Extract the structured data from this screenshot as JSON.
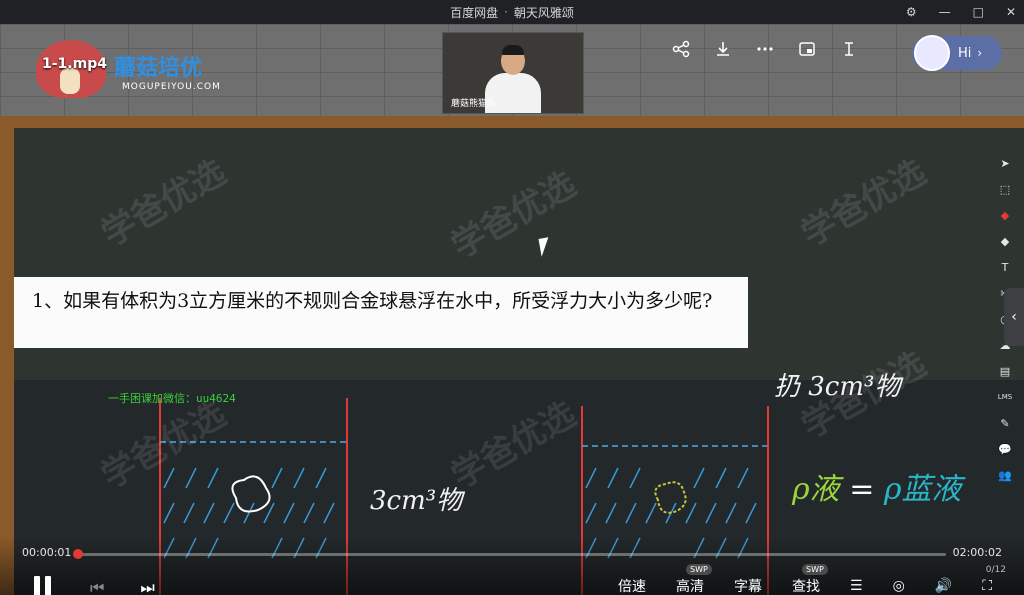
{
  "window": {
    "app_title": "百度网盘",
    "separator": "·",
    "video_title": "朝天风雅颂"
  },
  "header": {
    "file_name": "1-1.mp4",
    "brand": "蘑菇培优",
    "brand_sub": "MOGUPEIYOU.COM",
    "webcam_label": "蘑菇熊猫头",
    "hi_label": "Hi",
    "icons": [
      "share-icon",
      "download-icon",
      "more-icon",
      "picture-in-picture-icon",
      "pin-icon"
    ]
  },
  "board": {
    "question": "1、如果有体积为3立方厘米的不规则合金球悬浮在水中，所受浮力大小为多少呢?",
    "wechat_note": "一手困课加微信：uu4624",
    "handwriting_top_right": "扔 3cm³物",
    "handwriting_mid": "3cm³物",
    "formula_left": "ρ液",
    "formula_eq": "=",
    "formula_right": "ρ蓝液",
    "watermark": "学爸优选"
  },
  "toolbar_right": [
    "T",
    "✂",
    "○",
    "☁",
    "▤",
    "LMS",
    "✎",
    "💬",
    "👥"
  ],
  "player": {
    "time_current": "00:00:01",
    "time_total": "02:00:02",
    "progress_fraction": 0.001,
    "counter": "0/12",
    "speed_label": "倍速",
    "quality_label": "高清",
    "quality_badge": "SWP",
    "subtitle_label": "字幕",
    "search_label": "查找",
    "search_badge": "SWP",
    "accent": "#e53935"
  }
}
